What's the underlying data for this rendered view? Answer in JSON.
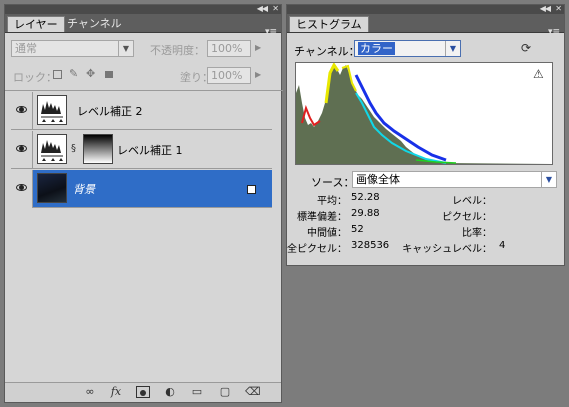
{
  "layers_panel": {
    "tabs": [
      "レイヤー",
      "チャンネル"
    ],
    "blend_mode": "通常",
    "opacity_label": "不透明度：",
    "opacity_value": "100%",
    "lock_label": "ロック：",
    "fill_label": "塗り：",
    "fill_value": "100%",
    "layers": [
      {
        "name": "レベル補正 2",
        "selected": false
      },
      {
        "name": "レベル補正 1",
        "selected": false
      },
      {
        "name": "背景",
        "selected": true
      }
    ]
  },
  "histogram_panel": {
    "tab": "ヒストグラム",
    "channel_label": "チャンネル：",
    "channel_value": "カラー",
    "source_label": "ソース：",
    "source_value": "画像全体",
    "stats_left": [
      {
        "label": "平均：",
        "value": "52.28"
      },
      {
        "label": "標準偏差：",
        "value": "29.88"
      },
      {
        "label": "中間値：",
        "value": "52"
      },
      {
        "label": "全ピクセル：",
        "value": "328536"
      }
    ],
    "stats_right": [
      {
        "label": "レベル：",
        "value": ""
      },
      {
        "label": "ピクセル：",
        "value": ""
      },
      {
        "label": "比率：",
        "value": ""
      },
      {
        "label": "キャッシュレベル：",
        "value": "4"
      }
    ]
  },
  "colors": {
    "selection": "#2f6dc7",
    "histogram_fill": "#5f6f52",
    "histogram_red": "#e02020",
    "histogram_yellow": "#e8e800",
    "histogram_cyan": "#10d8e8",
    "histogram_blue": "#1830e8",
    "histogram_green": "#20d020"
  }
}
